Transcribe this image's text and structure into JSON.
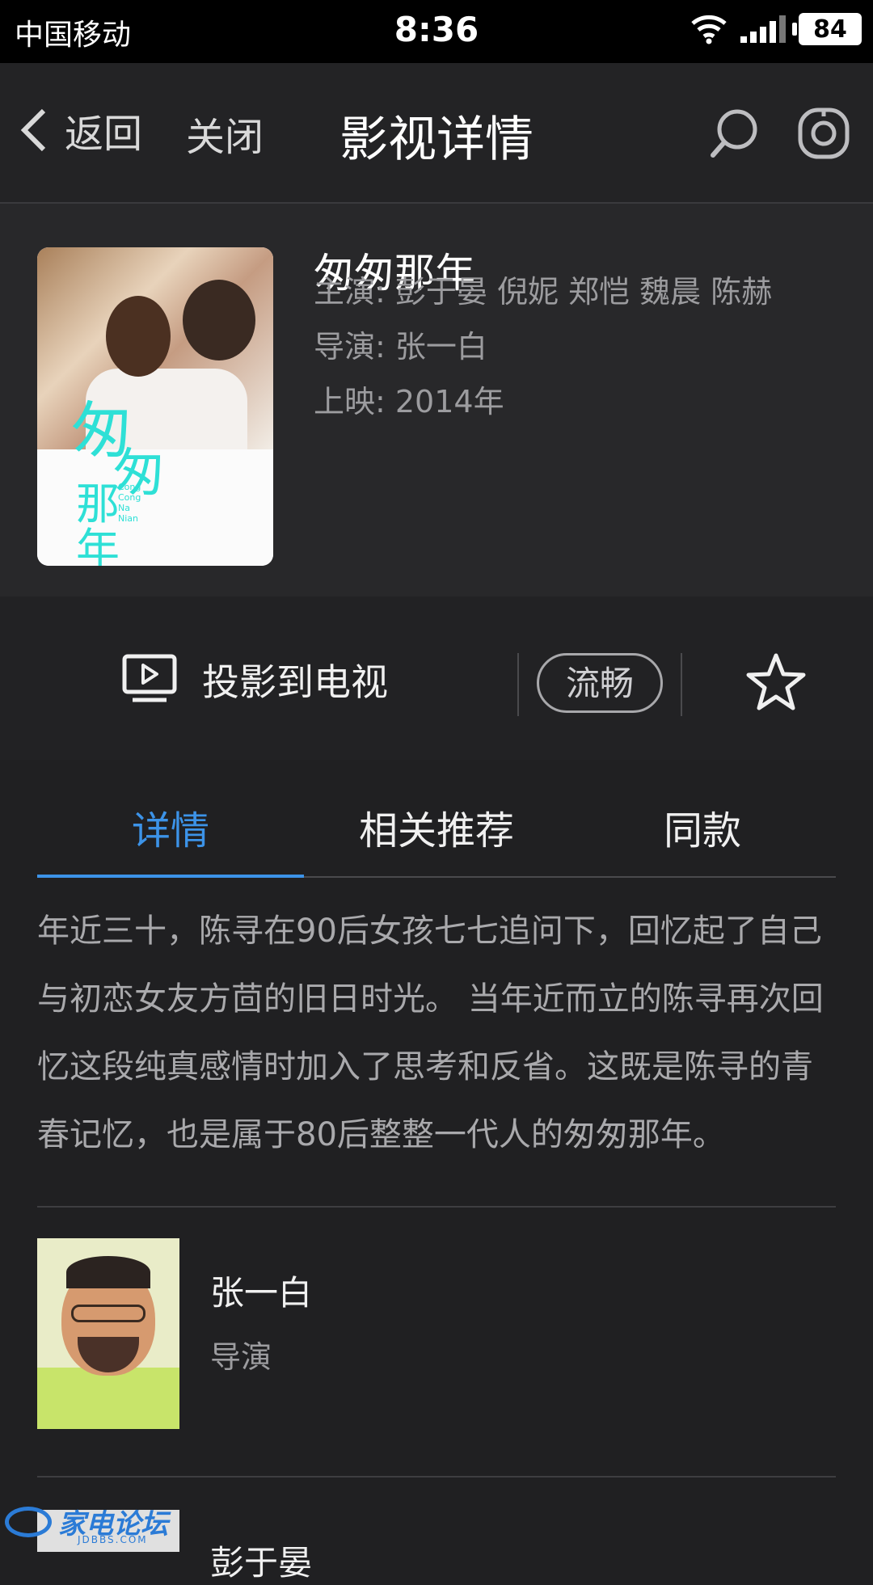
{
  "status_bar": {
    "carrier": "中国移动",
    "time": "8:36",
    "battery": "84"
  },
  "nav": {
    "back_label": "返回",
    "close_label": "关闭",
    "title": "影视详情",
    "search_icon": "search-icon",
    "settings_icon": "settings-icon"
  },
  "movie": {
    "title": "匆匆那年",
    "cast": "主演: 彭于晏 倪妮 郑恺 魏晨 陈赫",
    "director": "导演: 张一白",
    "release": "上映: 2014年",
    "poster_text": {
      "big1": "匆",
      "big2": "匆",
      "big3": "那年",
      "small": "Cong Cong Na Nian"
    }
  },
  "actions": {
    "cast_label": "投影到电视",
    "quality": "流畅",
    "favorite_icon": "star-icon"
  },
  "tabs": [
    {
      "label": "详情",
      "active": true
    },
    {
      "label": "相关推荐",
      "active": false
    },
    {
      "label": "同款",
      "active": false
    }
  ],
  "description": "年近三十，陈寻在90后女孩七七追问下，回忆起了自己与初恋女友方茴的旧日时光。 当年近而立的陈寻再次回忆这段纯真感情时加入了思考和反省。这既是陈寻的青春记忆，也是属于80后整整一代人的匆匆那年。",
  "people": [
    {
      "name": "张一白",
      "role": "导演"
    },
    {
      "name": "彭于晏",
      "role": ""
    }
  ],
  "watermark": {
    "text": "家电论坛",
    "sub": "JDBBS.COM"
  },
  "colors": {
    "accent": "#3c93e8",
    "background": "#202022"
  }
}
